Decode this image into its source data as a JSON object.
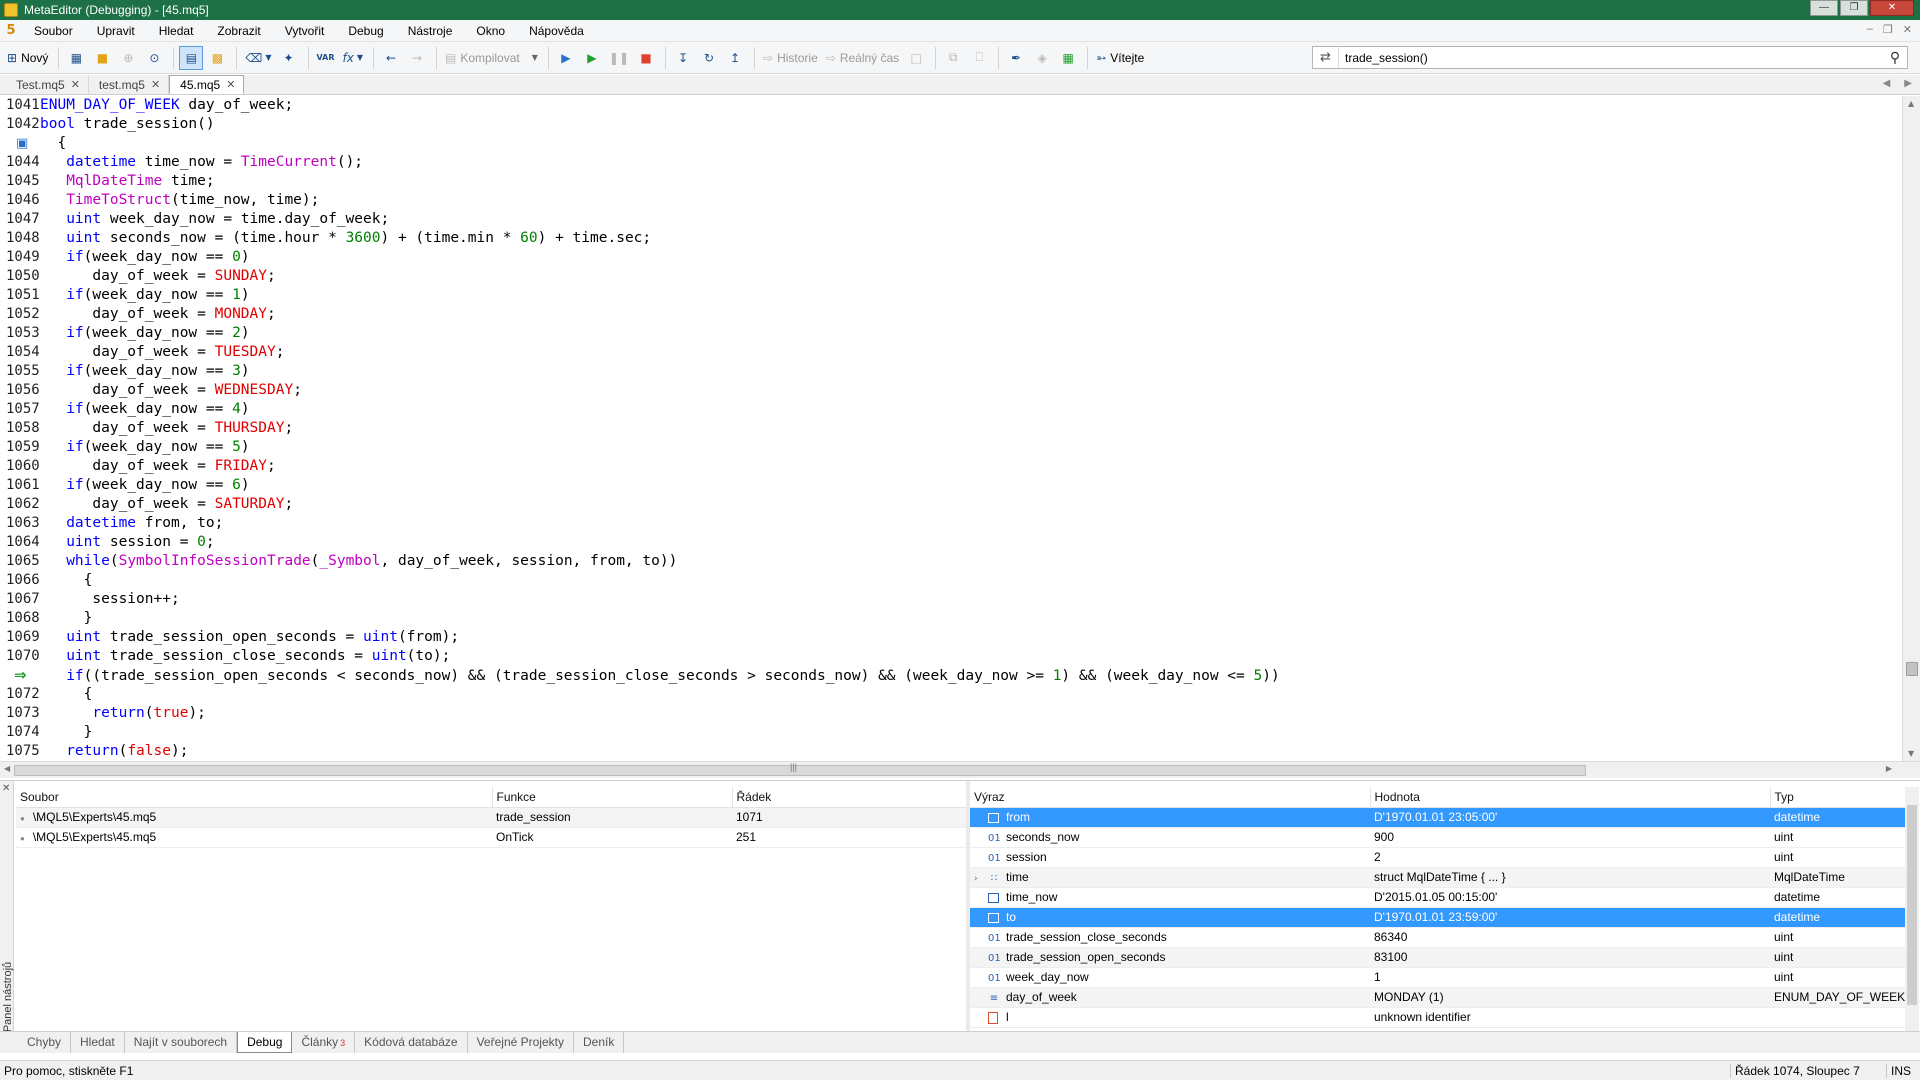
{
  "window": {
    "title": "MetaEditor (Debugging) - [45.mq5]"
  },
  "menu": [
    "Soubor",
    "Upravit",
    "Hledat",
    "Zobrazit",
    "Vytvořit",
    "Debug",
    "Nástroje",
    "Okno",
    "Nápověda"
  ],
  "toolbar": {
    "new_label": "Nový",
    "compile_label": "Kompilovat",
    "history_label": "Historie",
    "realtime_label": "Reálný čas",
    "welcome_label": "Vítejte",
    "var_label": "VAR",
    "fx_label": "fx",
    "search_value": "trade_session()"
  },
  "tabs": [
    {
      "label": "Test.mq5",
      "active": false
    },
    {
      "label": "test.mq5",
      "active": false
    },
    {
      "label": "45.mq5",
      "active": true
    }
  ],
  "code": [
    {
      "n": "1041",
      "t": [
        [
          "ty",
          "ENUM_DAY_OF_WEEK"
        ],
        [
          "cd",
          " day_of_week;"
        ]
      ]
    },
    {
      "n": "1042",
      "t": [
        [
          "ty",
          "bool"
        ],
        [
          "cd",
          " trade_session()"
        ]
      ]
    },
    {
      "n": "",
      "m": "bp",
      "t": [
        [
          "cd",
          "  {"
        ]
      ]
    },
    {
      "n": "1044",
      "t": [
        [
          "cd",
          "   "
        ],
        [
          "ty",
          "datetime"
        ],
        [
          "cd",
          " time_now = "
        ],
        [
          "fn",
          "TimeCurrent"
        ],
        [
          "cd",
          "();"
        ]
      ]
    },
    {
      "n": "1045",
      "t": [
        [
          "cd",
          "   "
        ],
        [
          "fn",
          "MqlDateTime"
        ],
        [
          "cd",
          " time;"
        ]
      ]
    },
    {
      "n": "1046",
      "t": [
        [
          "cd",
          "   "
        ],
        [
          "fn",
          "TimeToStruct"
        ],
        [
          "cd",
          "(time_now, time);"
        ]
      ]
    },
    {
      "n": "1047",
      "t": [
        [
          "cd",
          "   "
        ],
        [
          "ty",
          "uint"
        ],
        [
          "cd",
          " week_day_now = time.day_of_week;"
        ]
      ]
    },
    {
      "n": "1048",
      "t": [
        [
          "cd",
          "   "
        ],
        [
          "ty",
          "uint"
        ],
        [
          "cd",
          " seconds_now = (time.hour * "
        ],
        [
          "nm",
          "3600"
        ],
        [
          "cd",
          ") + (time.min * "
        ],
        [
          "nm",
          "60"
        ],
        [
          "cd",
          ") + time.sec;"
        ]
      ]
    },
    {
      "n": "1049",
      "t": [
        [
          "cd",
          "   "
        ],
        [
          "kw",
          "if"
        ],
        [
          "cd",
          "(week_day_now == "
        ],
        [
          "nm",
          "0"
        ],
        [
          "cd",
          ")"
        ]
      ]
    },
    {
      "n": "1050",
      "t": [
        [
          "cd",
          "      day_of_week = "
        ],
        [
          "en",
          "SUNDAY"
        ],
        [
          "cd",
          ";"
        ]
      ]
    },
    {
      "n": "1051",
      "t": [
        [
          "cd",
          "   "
        ],
        [
          "kw",
          "if"
        ],
        [
          "cd",
          "(week_day_now == "
        ],
        [
          "nm",
          "1"
        ],
        [
          "cd",
          ")"
        ]
      ]
    },
    {
      "n": "1052",
      "t": [
        [
          "cd",
          "      day_of_week = "
        ],
        [
          "en",
          "MONDAY"
        ],
        [
          "cd",
          ";"
        ]
      ]
    },
    {
      "n": "1053",
      "t": [
        [
          "cd",
          "   "
        ],
        [
          "kw",
          "if"
        ],
        [
          "cd",
          "(week_day_now == "
        ],
        [
          "nm",
          "2"
        ],
        [
          "cd",
          ")"
        ]
      ]
    },
    {
      "n": "1054",
      "t": [
        [
          "cd",
          "      day_of_week = "
        ],
        [
          "en",
          "TUESDAY"
        ],
        [
          "cd",
          ";"
        ]
      ]
    },
    {
      "n": "1055",
      "t": [
        [
          "cd",
          "   "
        ],
        [
          "kw",
          "if"
        ],
        [
          "cd",
          "(week_day_now == "
        ],
        [
          "nm",
          "3"
        ],
        [
          "cd",
          ")"
        ]
      ]
    },
    {
      "n": "1056",
      "t": [
        [
          "cd",
          "      day_of_week = "
        ],
        [
          "en",
          "WEDNESDAY"
        ],
        [
          "cd",
          ";"
        ]
      ]
    },
    {
      "n": "1057",
      "t": [
        [
          "cd",
          "   "
        ],
        [
          "kw",
          "if"
        ],
        [
          "cd",
          "(week_day_now == "
        ],
        [
          "nm",
          "4"
        ],
        [
          "cd",
          ")"
        ]
      ]
    },
    {
      "n": "1058",
      "t": [
        [
          "cd",
          "      day_of_week = "
        ],
        [
          "en",
          "THURSDAY"
        ],
        [
          "cd",
          ";"
        ]
      ]
    },
    {
      "n": "1059",
      "t": [
        [
          "cd",
          "   "
        ],
        [
          "kw",
          "if"
        ],
        [
          "cd",
          "(week_day_now == "
        ],
        [
          "nm",
          "5"
        ],
        [
          "cd",
          ")"
        ]
      ]
    },
    {
      "n": "1060",
      "t": [
        [
          "cd",
          "      day_of_week = "
        ],
        [
          "en",
          "FRIDAY"
        ],
        [
          "cd",
          ";"
        ]
      ]
    },
    {
      "n": "1061",
      "t": [
        [
          "cd",
          "   "
        ],
        [
          "kw",
          "if"
        ],
        [
          "cd",
          "(week_day_now == "
        ],
        [
          "nm",
          "6"
        ],
        [
          "cd",
          ")"
        ]
      ]
    },
    {
      "n": "1062",
      "t": [
        [
          "cd",
          "      day_of_week = "
        ],
        [
          "en",
          "SATURDAY"
        ],
        [
          "cd",
          ";"
        ]
      ]
    },
    {
      "n": "1063",
      "t": [
        [
          "cd",
          "   "
        ],
        [
          "ty",
          "datetime"
        ],
        [
          "cd",
          " from, to;"
        ]
      ]
    },
    {
      "n": "1064",
      "t": [
        [
          "cd",
          "   "
        ],
        [
          "ty",
          "uint"
        ],
        [
          "cd",
          " session = "
        ],
        [
          "nm",
          "0"
        ],
        [
          "cd",
          ";"
        ]
      ]
    },
    {
      "n": "1065",
      "t": [
        [
          "cd",
          "   "
        ],
        [
          "kw",
          "while"
        ],
        [
          "cd",
          "("
        ],
        [
          "fn",
          "SymbolInfoSessionTrade"
        ],
        [
          "cd",
          "("
        ],
        [
          "fn",
          "_Symbol"
        ],
        [
          "cd",
          ", day_of_week, session, from, to))"
        ]
      ]
    },
    {
      "n": "1066",
      "t": [
        [
          "cd",
          "     {"
        ]
      ]
    },
    {
      "n": "1067",
      "t": [
        [
          "cd",
          "      session++;"
        ]
      ]
    },
    {
      "n": "1068",
      "t": [
        [
          "cd",
          "     }"
        ]
      ]
    },
    {
      "n": "1069",
      "t": [
        [
          "cd",
          "   "
        ],
        [
          "ty",
          "uint"
        ],
        [
          "cd",
          " trade_session_open_seconds = "
        ],
        [
          "ty",
          "uint"
        ],
        [
          "cd",
          "(from);"
        ]
      ]
    },
    {
      "n": "1070",
      "t": [
        [
          "cd",
          "   "
        ],
        [
          "ty",
          "uint"
        ],
        [
          "cd",
          " trade_session_close_seconds = "
        ],
        [
          "ty",
          "uint"
        ],
        [
          "cd",
          "(to);"
        ]
      ]
    },
    {
      "n": "",
      "m": "arrow",
      "t": [
        [
          "cd",
          "   "
        ],
        [
          "kw",
          "if"
        ],
        [
          "cd",
          "((trade_session_open_seconds < seconds_now) && (trade_session_close_seconds > seconds_now) && (week_day_now >= "
        ],
        [
          "nm",
          "1"
        ],
        [
          "cd",
          ") && (week_day_now <= "
        ],
        [
          "nm",
          "5"
        ],
        [
          "cd",
          "))"
        ]
      ]
    },
    {
      "n": "1072",
      "t": [
        [
          "cd",
          "     {"
        ]
      ]
    },
    {
      "n": "1073",
      "t": [
        [
          "cd",
          "      "
        ],
        [
          "kw",
          "return"
        ],
        [
          "cd",
          "("
        ],
        [
          "en",
          "true"
        ],
        [
          "cd",
          ");"
        ]
      ]
    },
    {
      "n": "1074",
      "t": [
        [
          "cd",
          "     }"
        ]
      ]
    },
    {
      "n": "1075",
      "t": [
        [
          "cd",
          "   "
        ],
        [
          "kw",
          "return"
        ],
        [
          "cd",
          "("
        ],
        [
          "en",
          "false"
        ],
        [
          "cd",
          ");"
        ]
      ]
    }
  ],
  "callstack": {
    "headers": [
      "Soubor",
      "Funkce",
      "Řádek"
    ],
    "rows": [
      {
        "file": "\\MQL5\\Experts\\45.mq5",
        "func": "trade_session",
        "line": "1071"
      },
      {
        "file": "\\MQL5\\Experts\\45.mq5",
        "func": "OnTick",
        "line": "251"
      }
    ]
  },
  "watch": {
    "headers": [
      "Výraz",
      "Hodnota",
      "Typ"
    ],
    "rows": [
      {
        "icon": "tbl",
        "expr": "from",
        "value": "D'1970.01.01 23:05:00'",
        "type": "datetime",
        "sel": true
      },
      {
        "icon": "01",
        "expr": "seconds_now",
        "value": "900",
        "type": "uint"
      },
      {
        "icon": "01",
        "expr": "session",
        "value": "2",
        "type": "uint"
      },
      {
        "icon": "struct",
        "expr": "time",
        "value": "struct MqlDateTime { ... }",
        "type": "MqlDateTime",
        "zebra": true
      },
      {
        "icon": "tbl",
        "expr": "time_now",
        "value": "D'2015.01.05 00:15:00'",
        "type": "datetime"
      },
      {
        "icon": "tbl",
        "expr": "to",
        "value": "D'1970.01.01 23:59:00'",
        "type": "datetime",
        "sel": true
      },
      {
        "icon": "01",
        "expr": "trade_session_close_seconds",
        "value": "86340",
        "type": "uint"
      },
      {
        "icon": "01",
        "expr": "trade_session_open_seconds",
        "value": "83100",
        "type": "uint",
        "zebra": true
      },
      {
        "icon": "01",
        "expr": "week_day_now",
        "value": "1",
        "type": "uint"
      },
      {
        "icon": "enum",
        "expr": "day_of_week",
        "value": "MONDAY (1)",
        "type": "ENUM_DAY_OF_WEEK",
        "zebra": true
      },
      {
        "icon": "err",
        "expr": "l",
        "value": "unknown identifier",
        "type": ""
      }
    ]
  },
  "panel_label": "Panel nástrojů",
  "bottom_tabs": [
    {
      "label": "Chyby"
    },
    {
      "label": "Hledat"
    },
    {
      "label": "Najít v souborech"
    },
    {
      "label": "Debug",
      "active": true
    },
    {
      "label": "Články",
      "sub": "3"
    },
    {
      "label": "Kódová databáze"
    },
    {
      "label": "Veřejné Projekty"
    },
    {
      "label": "Deník"
    }
  ],
  "status": {
    "help": "Pro pomoc, stiskněte F1",
    "position": "Řádek 1074, Sloupec 7",
    "mode": "INS"
  }
}
